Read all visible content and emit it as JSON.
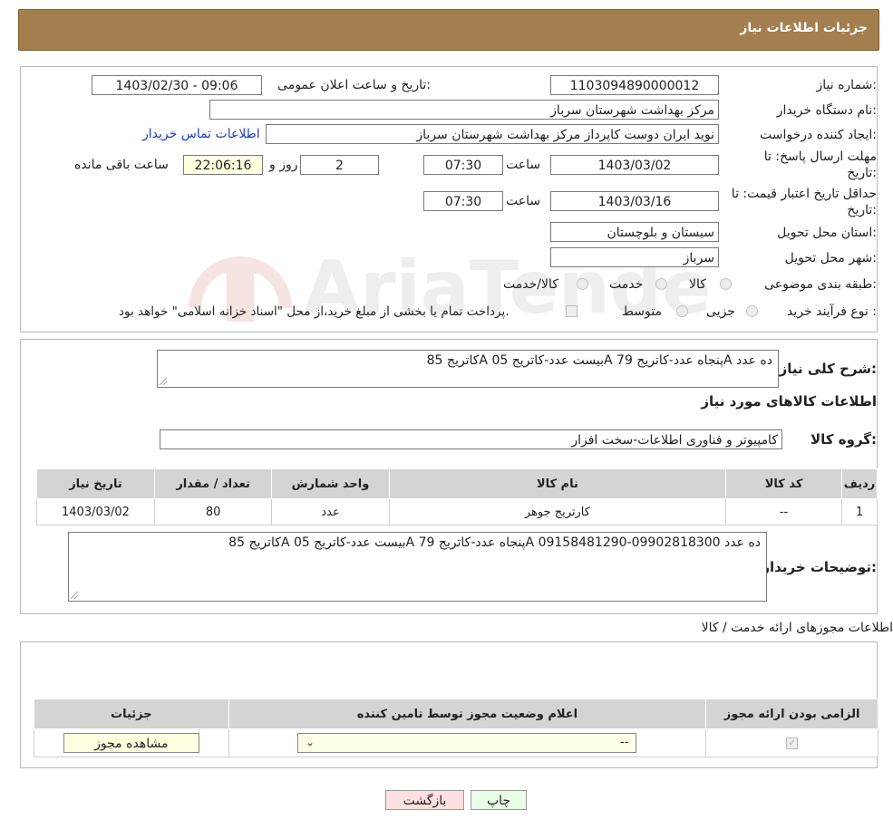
{
  "header": {
    "title": "جزئیات اطلاعات نیاز"
  },
  "form": {
    "need_number_label": "شماره نیاز:",
    "need_number": "1103094890000012",
    "announce_label": "تاریخ و ساعت اعلان عمومی:",
    "announce_value": "1403/02/30 - 09:06",
    "buyer_org_label": "نام دستگاه خریدار:",
    "buyer_org": "مرکز بهداشت شهرستان سرباز",
    "creator_label": "ایجاد کننده درخواست:",
    "creator": "نوید ایران دوست کاپرداز مرکز بهداشت شهرستان سرباز",
    "contact_link": "اطلاعات تماس خریدار",
    "deadline_label_1": "مهلت ارسال پاسخ: تا",
    "deadline_label_2": "تاریخ:",
    "deadline_date": "1403/03/02",
    "time_label": "ساعت",
    "deadline_time": "07:30",
    "days_value": "2",
    "days_label": "روز و",
    "remaining_time": "22:06:16",
    "remaining_label": "ساعت باقی مانده",
    "validity_label_1": "حداقل تاریخ اعتبار قیمت: تا",
    "validity_label_2": "تاریخ:",
    "validity_date": "1403/03/16",
    "validity_time": "07:30",
    "province_label": "استان محل تحویل:",
    "province": "سیستان و بلوچستان",
    "city_label": "شهر محل تحویل:",
    "city": "سرباز",
    "category_label": "طبقه بندی موضوعی:",
    "category_options": [
      "کالا",
      "خدمت",
      "کالا/خدمت"
    ],
    "process_label": "نوع فرآیند خرید :",
    "process_options": [
      "جزیی",
      "متوسط"
    ],
    "process_note": "پرداخت تمام یا بخشی از مبلغ خرید،از محل \"اسناد خزانه اسلامی\" خواهد بود."
  },
  "details": {
    "summary_label": "شرح کلی نیاز:",
    "summary": "کاتریج 85A بیست عدد-کاتریج 05A پنجاه عدد-کاتریج 79A ده عدد",
    "goods_title": "اطلاعات کالاهای مورد نیاز",
    "group_label": "گروه کالا:",
    "group": "کامپیوتر و فناوری اطلاعات-سخت افزار",
    "table_headers": [
      "ردیف",
      "کد کالا",
      "نام کالا",
      "واحد شمارش",
      "تعداد / مقدار",
      "تاریخ نیاز"
    ],
    "table_rows": [
      [
        "1",
        "--",
        "کارتریج جوهر",
        "عدد",
        "80",
        "1403/03/02"
      ]
    ],
    "buyer_notes_label": "توضیحات خریدار:",
    "buyer_notes": "کاتریج 85A بیست عدد-کاتریج 05A پنجاه عدد-کاتریج 79A ده عدد 09902818300-09158481290"
  },
  "permits": {
    "title": "اطلاعات مجوزهای ارائه خدمت / کالا",
    "headers": [
      "الزامی بودن ارائه مجوز",
      "اعلام وضعیت مجوز توسط تامین کننده",
      "جزئیات"
    ],
    "select_value": "--",
    "view_button": "مشاهده مجوز"
  },
  "buttons": {
    "print": "چاپ",
    "back": "بازگشت"
  },
  "watermark": {
    "text": "AriaTender.neT"
  },
  "colors": {
    "header_bg": "#a37f4f",
    "link": "#1a3ec8",
    "remaining_bg": "#ffffe0",
    "back_btn_bg": "#ffe0e0",
    "print_btn_bg": "#e8ffe8"
  }
}
